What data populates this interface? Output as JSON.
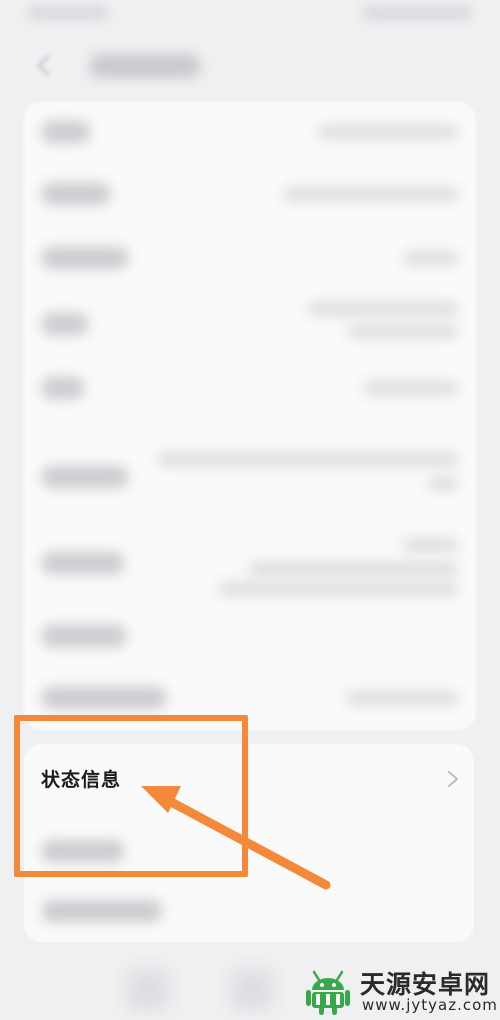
{
  "page": {
    "status_row_label": "状态信息"
  },
  "watermark": {
    "name": "天源安卓网",
    "url": "www.jytyaz.com"
  },
  "colors": {
    "highlight": "#f5893a",
    "background": "#eff0f2",
    "card": "#fafafa",
    "watermark_logo": "#3aa74a"
  },
  "icons": {
    "back": "back-arrow-icon",
    "chevron": "chevron-right-icon",
    "logo": "android-logo-icon"
  }
}
